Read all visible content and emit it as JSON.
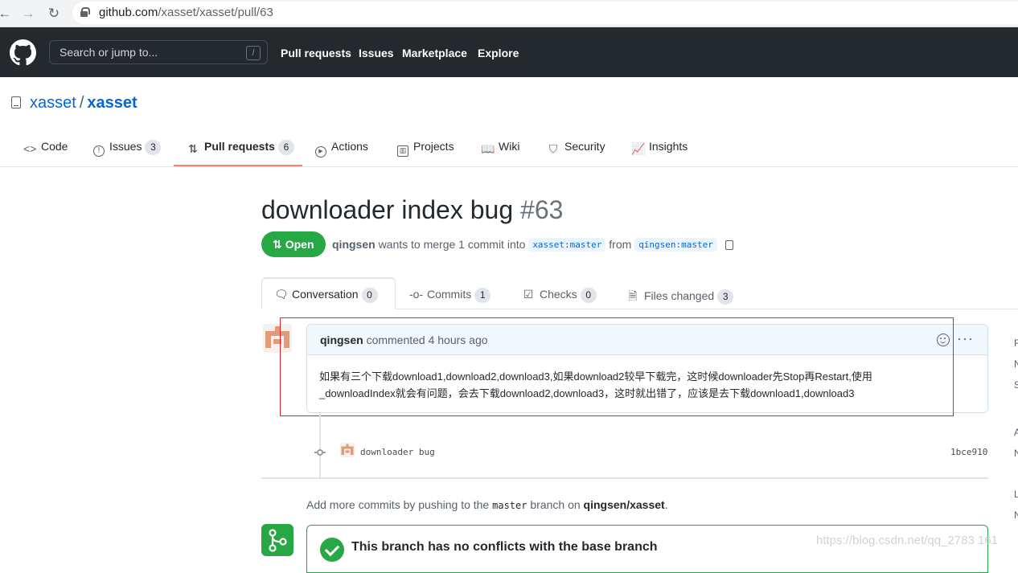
{
  "browser": {
    "url_domain": "github.com",
    "url_path": "/xasset/xasset/pull/63"
  },
  "header": {
    "search_placeholder": "Search or jump to...",
    "search_shortcut": "/",
    "nav": [
      "Pull requests",
      "Issues",
      "Marketplace",
      "Explore"
    ]
  },
  "repo": {
    "owner": "xasset",
    "name": "xasset"
  },
  "repo_tabs": [
    {
      "label": "Code",
      "count": ""
    },
    {
      "label": "Issues",
      "count": "3"
    },
    {
      "label": "Pull requests",
      "count": "6"
    },
    {
      "label": "Actions",
      "count": ""
    },
    {
      "label": "Projects",
      "count": ""
    },
    {
      "label": "Wiki",
      "count": ""
    },
    {
      "label": "Security",
      "count": ""
    },
    {
      "label": "Insights",
      "count": ""
    }
  ],
  "pr": {
    "title": "downloader index bug",
    "number": "#63",
    "state": "Open",
    "author": "qingsen",
    "merge_text": "wants to merge 1 commit into",
    "base_branch": "xasset:master",
    "from_text": "from",
    "head_branch": "qingsen:master"
  },
  "pr_tabs": [
    {
      "label": "Conversation",
      "count": "0"
    },
    {
      "label": "Commits",
      "count": "1"
    },
    {
      "label": "Checks",
      "count": "0"
    },
    {
      "label": "Files changed",
      "count": "3"
    }
  ],
  "comment": {
    "author": "qingsen",
    "action": "commented 4 hours ago",
    "more": "···",
    "body_line1": "如果有三个下载download1,download2,download3,如果download2较早下载完，这时候downloader先Stop再Restart,使用",
    "body_line2": "_downloadIndex就会有问题，会去下载download2,download3，这时就出错了，应该是去下载download1,download3"
  },
  "commit": {
    "message": "downloader bug",
    "sha": "1bce910"
  },
  "add_more": {
    "prefix": "Add more commits by pushing to the",
    "branch": "master",
    "middle": "branch on",
    "repo": "qingsen/xasset",
    "suffix": "."
  },
  "merge": {
    "title": "This branch has no conflicts with the base branch"
  },
  "sidebar_letters": [
    "R",
    "N",
    "S",
    "A",
    "N",
    "L",
    "N"
  ],
  "watermark": "https://blog.csdn.net/qq_2783 161",
  "colors": {
    "header_bg": "#24292e",
    "link": "#0366d6",
    "open_green": "#28a745",
    "tab_underline": "#f9826c",
    "highlight_box": "#e0222a"
  }
}
